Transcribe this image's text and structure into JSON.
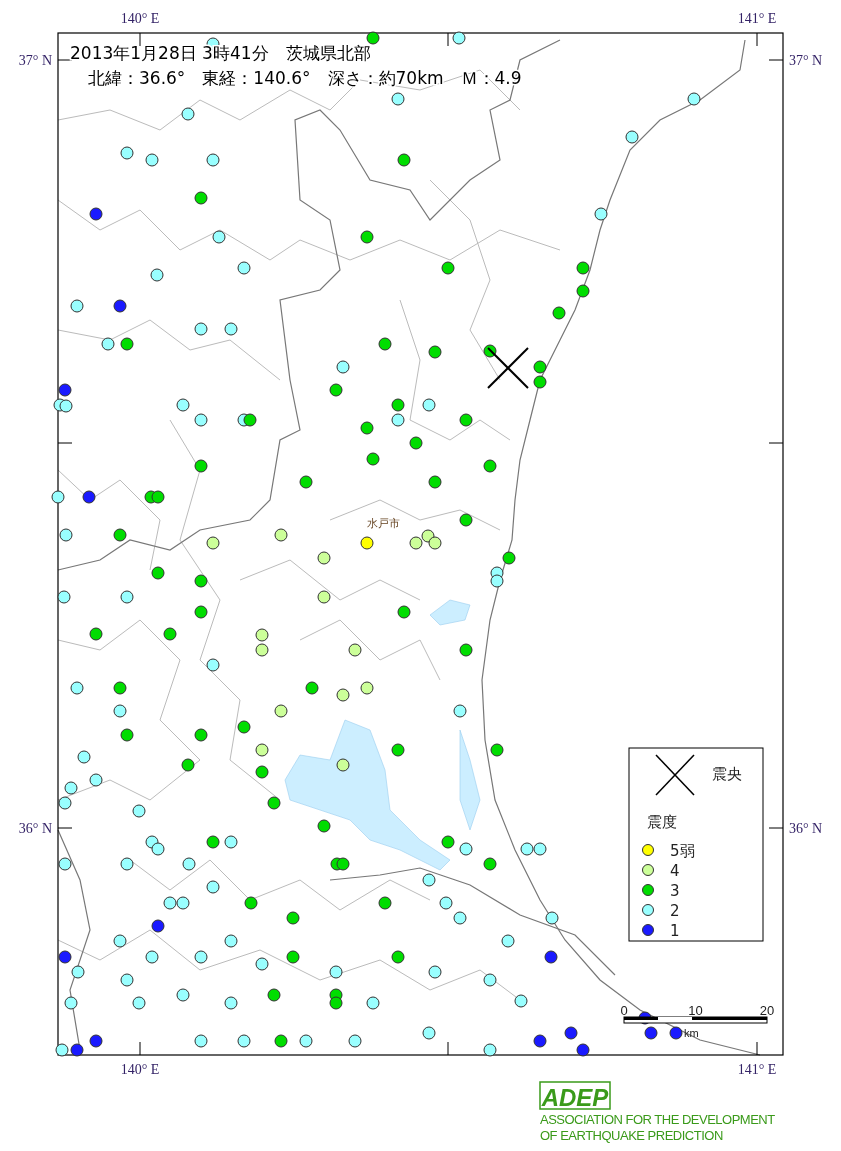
{
  "map": {
    "title": "2013年1月28日 3時41分　茨城県北部",
    "subtitle": "北緯：36.6°　東経：140.6°　深さ：約70km　Ｍ：4.9",
    "axis_labels": [
      {
        "text": "140° E"
      },
      {
        "text": "141° E"
      },
      {
        "text": "37° N"
      },
      {
        "text": "37° N"
      },
      {
        "text": "36° N"
      },
      {
        "text": "36° N"
      },
      {
        "text": "140° E"
      },
      {
        "text": "141° E"
      }
    ],
    "city_label": "水戸市",
    "stations": [
      {
        "color": "#99ffff"
      },
      {
        "color": "#00dd00"
      },
      {
        "color": "#99ffff"
      },
      {
        "color": "#99ffff"
      },
      {
        "color": "#99ffff"
      },
      {
        "color": "#99ffff"
      },
      {
        "color": "#99ffff"
      },
      {
        "color": "#99ffff"
      },
      {
        "color": "#99ffff"
      },
      {
        "color": "#99ffff"
      },
      {
        "color": "#00dd00"
      },
      {
        "color": "#00dd00"
      },
      {
        "color": "#1a1aff"
      },
      {
        "color": "#99ffff"
      },
      {
        "color": "#00dd00"
      },
      {
        "color": "#99ffff"
      },
      {
        "color": "#00dd00"
      },
      {
        "color": "#00dd00"
      },
      {
        "color": "#99ffff"
      },
      {
        "color": "#99ffff"
      },
      {
        "color": "#00dd00"
      },
      {
        "color": "#99ffff"
      },
      {
        "color": "#1a1aff"
      },
      {
        "color": "#00dd00"
      },
      {
        "color": "#99ffff"
      },
      {
        "color": "#99ffff"
      },
      {
        "color": "#00dd00"
      },
      {
        "color": "#00dd00"
      },
      {
        "color": "#00dd00"
      },
      {
        "color": "#99ffff"
      },
      {
        "color": "#00dd00"
      },
      {
        "color": "#99ffff"
      },
      {
        "color": "#00dd00"
      },
      {
        "color": "#00dd00"
      },
      {
        "color": "#1a1aff"
      },
      {
        "color": "#00dd00"
      },
      {
        "color": "#99ffff"
      },
      {
        "color": "#99ffff"
      },
      {
        "color": "#99ffff"
      },
      {
        "color": "#00dd00"
      },
      {
        "color": "#99ffff"
      },
      {
        "color": "#99ffff"
      },
      {
        "color": "#00dd00"
      },
      {
        "color": "#99ffff"
      },
      {
        "color": "#99ffff"
      },
      {
        "color": "#00dd00"
      },
      {
        "color": "#00dd00"
      },
      {
        "color": "#00dd00"
      },
      {
        "color": "#00dd00"
      },
      {
        "color": "#00dd00"
      },
      {
        "color": "#00dd00"
      },
      {
        "color": "#00dd00"
      },
      {
        "color": "#00dd00"
      },
      {
        "color": "#99ffff"
      },
      {
        "color": "#1a1aff"
      },
      {
        "color": "#00dd00"
      },
      {
        "color": "#00dd00"
      },
      {
        "color": "#00dd00"
      },
      {
        "color": "#99ffff"
      },
      {
        "color": "#00dd00"
      },
      {
        "color": "#ccff99"
      },
      {
        "color": "#ccff99"
      },
      {
        "color": "#ffff00"
      },
      {
        "color": "#ccff99"
      },
      {
        "color": "#ccff99"
      },
      {
        "color": "#ccff99"
      },
      {
        "color": "#ccff99"
      },
      {
        "color": "#00dd00"
      },
      {
        "color": "#99ffff"
      },
      {
        "color": "#99ffff"
      },
      {
        "color": "#00dd00"
      },
      {
        "color": "#00dd00"
      },
      {
        "color": "#99ffff"
      },
      {
        "color": "#99ffff"
      },
      {
        "color": "#ccff99"
      },
      {
        "color": "#00dd00"
      },
      {
        "color": "#00dd00"
      },
      {
        "color": "#00dd00"
      },
      {
        "color": "#00dd00"
      },
      {
        "color": "#ccff99"
      },
      {
        "color": "#ccff99"
      },
      {
        "color": "#ccff99"
      },
      {
        "color": "#00dd00"
      },
      {
        "color": "#99ffff"
      },
      {
        "color": "#99ffff"
      },
      {
        "color": "#00dd00"
      },
      {
        "color": "#00dd00"
      },
      {
        "color": "#ccff99"
      },
      {
        "color": "#ccff99"
      },
      {
        "color": "#99ffff"
      },
      {
        "color": "#ccff99"
      },
      {
        "color": "#99ffff"
      },
      {
        "color": "#00dd00"
      },
      {
        "color": "#00dd00"
      },
      {
        "color": "#00dd00"
      },
      {
        "color": "#ccff99"
      },
      {
        "color": "#00dd00"
      },
      {
        "color": "#00dd00"
      },
      {
        "color": "#99ffff"
      },
      {
        "color": "#00dd00"
      },
      {
        "color": "#ccff99"
      },
      {
        "color": "#00dd00"
      },
      {
        "color": "#99ffff"
      },
      {
        "color": "#99ffff"
      },
      {
        "color": "#00dd00"
      },
      {
        "color": "#99ffff"
      },
      {
        "color": "#99ffff"
      },
      {
        "color": "#00dd00"
      },
      {
        "color": "#99ffff"
      },
      {
        "color": "#99ffff"
      },
      {
        "color": "#00dd00"
      },
      {
        "color": "#99ffff"
      },
      {
        "color": "#00dd00"
      },
      {
        "color": "#99ffff"
      },
      {
        "color": "#99ffff"
      },
      {
        "color": "#99ffff"
      },
      {
        "color": "#99ffff"
      },
      {
        "color": "#99ffff"
      },
      {
        "color": "#99ffff"
      },
      {
        "color": "#00dd00"
      },
      {
        "color": "#00dd00"
      },
      {
        "color": "#00dd00"
      },
      {
        "color": "#99ffff"
      },
      {
        "color": "#99ffff"
      },
      {
        "color": "#99ffff"
      },
      {
        "color": "#99ffff"
      },
      {
        "color": "#00dd00"
      },
      {
        "color": "#00dd00"
      },
      {
        "color": "#99ffff"
      },
      {
        "color": "#99ffff"
      },
      {
        "color": "#99ffff"
      },
      {
        "color": "#00dd00"
      },
      {
        "color": "#1a1aff"
      },
      {
        "color": "#99ffff"
      },
      {
        "color": "#99ffff"
      },
      {
        "color": "#99ffff"
      },
      {
        "color": "#99ffff"
      },
      {
        "color": "#1a1aff"
      },
      {
        "color": "#99ffff"
      },
      {
        "color": "#00dd00"
      },
      {
        "color": "#00dd00"
      },
      {
        "color": "#1a1aff"
      },
      {
        "color": "#99ffff"
      },
      {
        "color": "#99ffff"
      },
      {
        "color": "#99ffff"
      },
      {
        "color": "#99ffff"
      },
      {
        "color": "#99ffff"
      },
      {
        "color": "#99ffff"
      },
      {
        "color": "#99ffff"
      },
      {
        "color": "#99ffff"
      },
      {
        "color": "#99ffff"
      },
      {
        "color": "#00dd00"
      },
      {
        "color": "#00dd00"
      },
      {
        "color": "#00dd00"
      },
      {
        "color": "#99ffff"
      },
      {
        "color": "#99ffff"
      },
      {
        "color": "#99ffff"
      },
      {
        "color": "#1a1aff"
      },
      {
        "color": "#99ffff"
      },
      {
        "color": "#99ffff"
      },
      {
        "color": "#00dd00"
      },
      {
        "color": "#99ffff"
      },
      {
        "color": "#99ffff"
      },
      {
        "color": "#99ffff"
      },
      {
        "color": "#1a1aff"
      },
      {
        "color": "#1a1aff"
      },
      {
        "color": "#1a1aff"
      },
      {
        "color": "#1a1aff"
      },
      {
        "color": "#1a1aff"
      },
      {
        "color": "#99ffff"
      },
      {
        "color": "#1a1aff"
      },
      {
        "color": "#99ffff"
      },
      {
        "color": "#1a1aff"
      }
    ]
  },
  "legend": {
    "epicenter_label": "震央",
    "intensity_title": "震度",
    "items": [
      {
        "label": "5弱",
        "color": "#ffff00"
      },
      {
        "label": "4",
        "color": "#ccff99"
      },
      {
        "label": "3",
        "color": "#00dd00"
      },
      {
        "label": "2",
        "color": "#99ffff"
      },
      {
        "label": "1",
        "color": "#1a1aff"
      }
    ]
  },
  "scale_bar": {
    "ticks": [
      "0",
      "10",
      "20"
    ],
    "unit": "km"
  },
  "logo": {
    "mark": "ADEP",
    "lines": [
      "ASSOCIATION FOR THE DEVELOPMENT",
      "OF EARTHQUAKE PREDICTION"
    ]
  }
}
